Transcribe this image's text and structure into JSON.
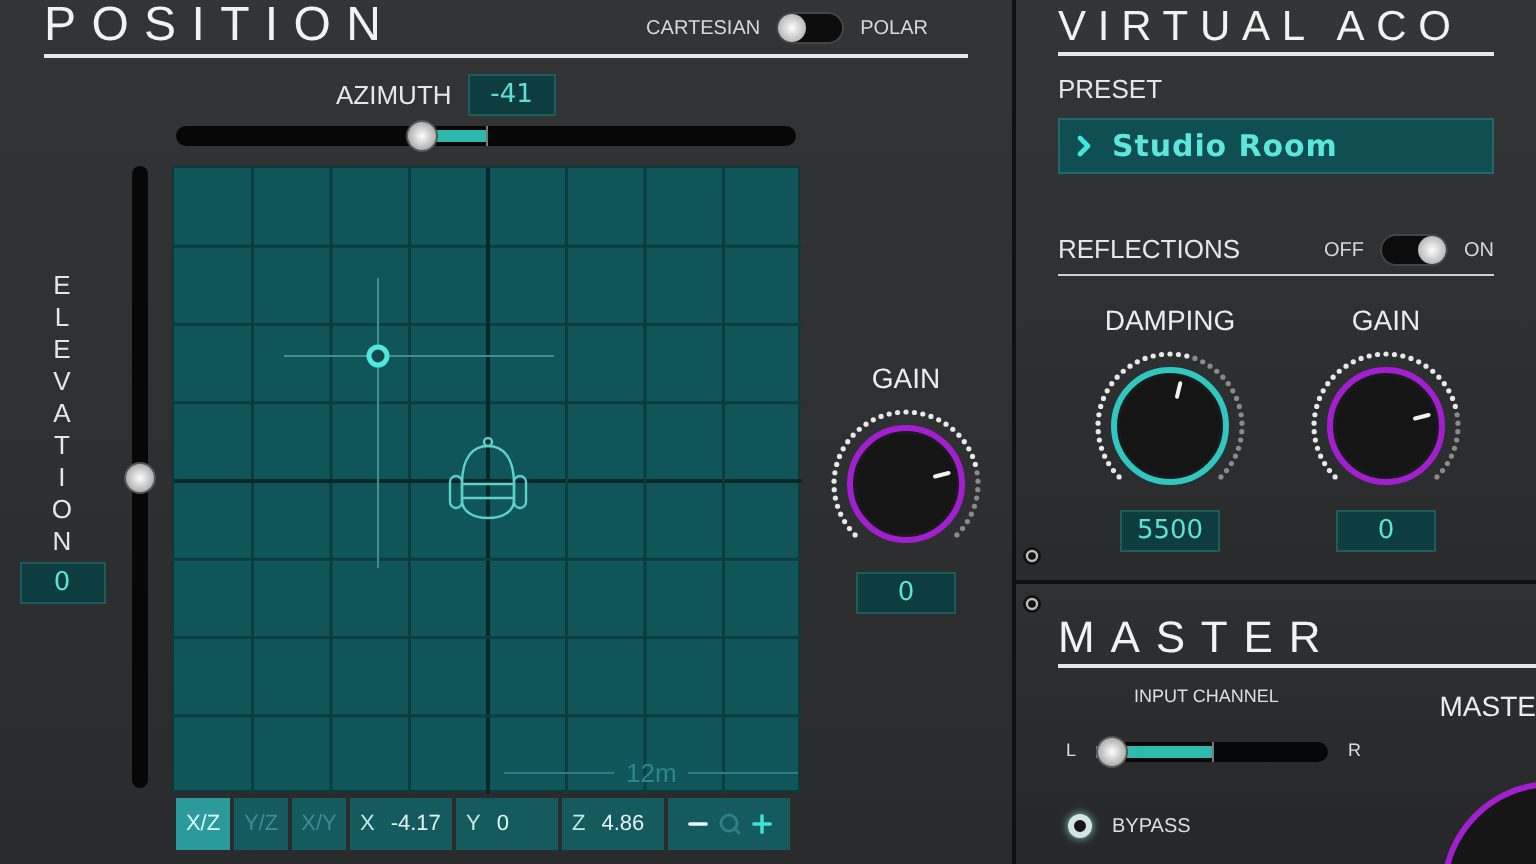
{
  "position": {
    "title": "POSITION",
    "mode_toggle": {
      "left_label": "CARTESIAN",
      "right_label": "POLAR",
      "on": false
    },
    "azimuth": {
      "label": "AZIMUTH",
      "value": "-41",
      "level": 0.39
    },
    "elevation": {
      "label": "ELEVATION",
      "value": "0",
      "level": 0.5
    },
    "grid": {
      "scale_label": "12m"
    },
    "view_tabs": [
      {
        "label": "X/Z",
        "selected": true
      },
      {
        "label": "Y/Z",
        "selected": false
      },
      {
        "label": "X/Y",
        "selected": false
      }
    ],
    "coordinates": [
      {
        "label": "X",
        "value": "-4.17"
      },
      {
        "label": "Y",
        "value": "0"
      },
      {
        "label": "Z",
        "value": "4.86"
      }
    ],
    "gain": {
      "label": "GAIN",
      "value": "0",
      "level": 0.78
    }
  },
  "virtual_acoustics": {
    "title": "VIRTUAL ACO",
    "preset": {
      "label": "PRESET",
      "value": "Studio Room"
    },
    "reflections": {
      "label": "REFLECTIONS",
      "off_label": "OFF",
      "on_label": "ON",
      "on": true
    },
    "knobs": [
      {
        "label": "DAMPING",
        "value": "5500",
        "level": 0.55,
        "color": "#2fc7c0"
      },
      {
        "label": "GAIN",
        "value": "0",
        "level": 0.78,
        "color": "#a21fd0"
      }
    ]
  },
  "master": {
    "title": "MASTER",
    "input_channel": {
      "label": "INPUT CHANNEL",
      "left_label": "L",
      "right_label": "R",
      "level": 0
    },
    "output_label": "MASTE",
    "options": [
      {
        "label": "BYPASS",
        "selected": true
      }
    ]
  }
}
